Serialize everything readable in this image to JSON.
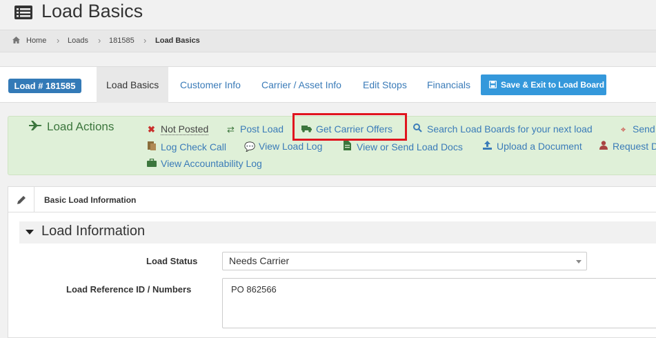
{
  "header": {
    "title": "Load Basics",
    "icon": "list-icon"
  },
  "breadcrumb": {
    "home": "Home",
    "loads": "Loads",
    "load_id": "181585",
    "current": "Load Basics"
  },
  "tabs": {
    "load_badge": "Load # 181585",
    "items": [
      "Load Basics",
      "Customer Info",
      "Carrier / Asset Info",
      "Edit Stops",
      "Financials"
    ],
    "active": "Load Basics",
    "save_label": "Save & Exit to Load Board"
  },
  "actions": {
    "title": "Load Actions",
    "items": [
      {
        "label": "Not Posted",
        "icon": "x-icon"
      },
      {
        "label": "Post Load",
        "icon": "retweet-icon"
      },
      {
        "label": "Get Carrier Offers",
        "icon": "truck-icon"
      },
      {
        "label": "Search Load Boards for your next load",
        "icon": "search-icon"
      },
      {
        "label": "Send",
        "icon": "crosshair-icon"
      },
      {
        "label": "Log Check Call",
        "icon": "clipboard-icon"
      },
      {
        "label": "View Load Log",
        "icon": "comments-icon"
      },
      {
        "label": "View or Send Load Docs",
        "icon": "document-icon"
      },
      {
        "label": "Upload a Document",
        "icon": "upload-icon"
      },
      {
        "label": "Request D",
        "icon": "user-icon"
      },
      {
        "label": "View Accountability Log",
        "icon": "briefcase-icon"
      }
    ]
  },
  "panel": {
    "title": "Basic Load Information",
    "section_title": "Load Information",
    "load_status_label": "Load Status",
    "load_status_value": "Needs Carrier",
    "reference_label": "Load Reference ID / Numbers",
    "reference_value": "PO 862566"
  },
  "colors": {
    "accent": "#337ab7",
    "save_button": "#3498db",
    "actions_bg": "#dff0d8",
    "highlight": "#e0141e"
  }
}
